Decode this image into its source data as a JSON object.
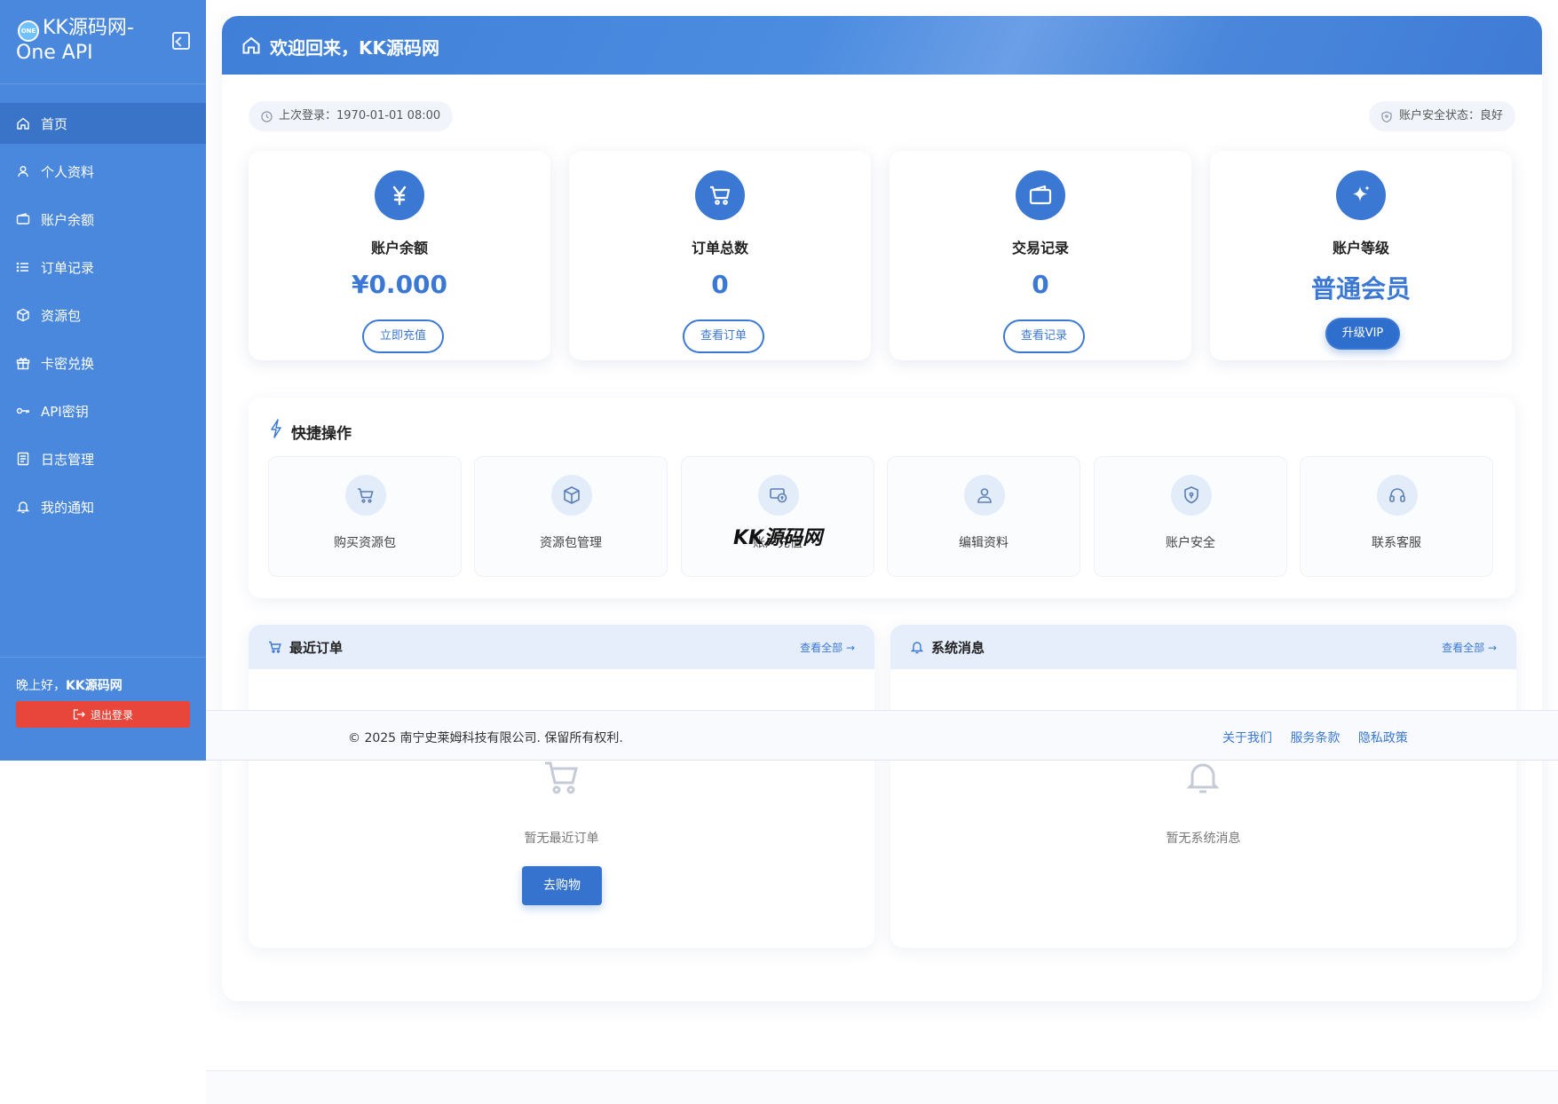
{
  "sidebar": {
    "brand_logo": "ONE",
    "brand_line1": "KK源码网-",
    "brand_line2": "One API",
    "items": [
      {
        "label": "首页",
        "icon": "home-icon",
        "active": true
      },
      {
        "label": "个人资料",
        "icon": "user-icon"
      },
      {
        "label": "账户余额",
        "icon": "wallet-icon"
      },
      {
        "label": "订单记录",
        "icon": "list-icon"
      },
      {
        "label": "资源包",
        "icon": "box-icon"
      },
      {
        "label": "卡密兑换",
        "icon": "gift-icon"
      },
      {
        "label": "API密钥",
        "icon": "key-icon"
      },
      {
        "label": "日志管理",
        "icon": "log-icon"
      },
      {
        "label": "我的通知",
        "icon": "bell-icon"
      }
    ],
    "greeting_prefix": "晚上好，",
    "greeting_name": "KK源码网",
    "logout_label": "退出登录"
  },
  "header": {
    "title": "欢迎回来，KK源码网"
  },
  "info": {
    "last_login": "上次登录：1970-01-01 08:00",
    "security_status": "账户安全状态：良好"
  },
  "stats": [
    {
      "label": "账户余额",
      "value": "¥0.000",
      "button": "立即充值",
      "icon": "yen-icon"
    },
    {
      "label": "订单总数",
      "value": "0",
      "button": "查看订单",
      "icon": "cart-icon"
    },
    {
      "label": "交易记录",
      "value": "0",
      "button": "查看记录",
      "icon": "wallet-icon"
    },
    {
      "label": "账户等级",
      "value": "普通会员",
      "button": "升级VIP",
      "icon": "sparkle-icon"
    }
  ],
  "quick": {
    "title": "快捷操作",
    "items": [
      {
        "label": "购买资源包",
        "icon": "cart-icon"
      },
      {
        "label": "资源包管理",
        "icon": "box-icon"
      },
      {
        "label": "账户充值",
        "icon": "recharge-icon"
      },
      {
        "label": "编辑资料",
        "icon": "user-icon"
      },
      {
        "label": "账户安全",
        "icon": "shield-icon"
      },
      {
        "label": "联系客服",
        "icon": "headset-icon"
      }
    ]
  },
  "orders_panel": {
    "title": "最近订单",
    "link": "查看全部 →",
    "empty_text": "暂无最近订单",
    "button": "去购物"
  },
  "messages_panel": {
    "title": "系统消息",
    "link": "查看全部 →",
    "empty_text": "暂无系统消息"
  },
  "footer": {
    "copyright": "© 2025 南宁史莱姆科技有限公司. 保留所有权利.",
    "links": [
      "关于我们",
      "服务条款",
      "隐私政策"
    ]
  },
  "watermark": "KK源码网",
  "colors": {
    "sidebar": "#4a88dd",
    "accent": "#3b78d4",
    "danger": "#e9463b"
  }
}
